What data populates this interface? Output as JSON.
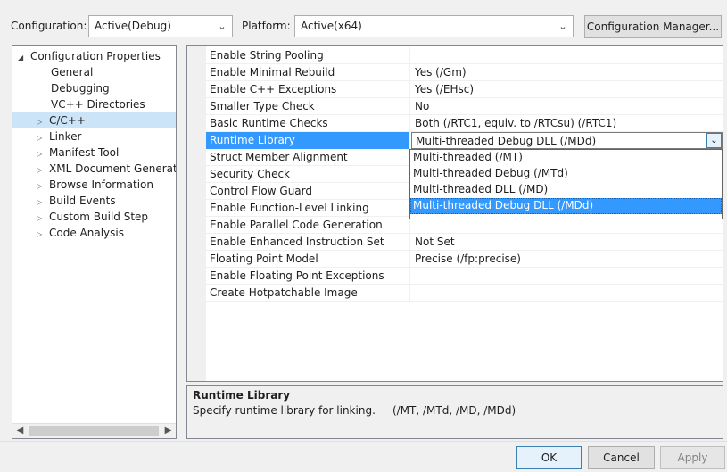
{
  "toolbar": {
    "configuration_label": "Configuration:",
    "configuration_value": "Active(Debug)",
    "platform_label": "Platform:",
    "platform_value": "Active(x64)",
    "config_manager_label": "Configuration Manager..."
  },
  "tree": {
    "items": [
      {
        "label": "Configuration Properties",
        "expander": "◢"
      },
      {
        "label": "General",
        "expander": ""
      },
      {
        "label": "Debugging",
        "expander": ""
      },
      {
        "label": "VC++ Directories",
        "expander": ""
      },
      {
        "label": "C/C++",
        "expander": "▷"
      },
      {
        "label": "Linker",
        "expander": "▷"
      },
      {
        "label": "Manifest Tool",
        "expander": "▷"
      },
      {
        "label": "XML Document Generator",
        "expander": "▷"
      },
      {
        "label": "Browse Information",
        "expander": "▷"
      },
      {
        "label": "Build Events",
        "expander": "▷"
      },
      {
        "label": "Custom Build Step",
        "expander": "▷"
      },
      {
        "label": "Code Analysis",
        "expander": "▷"
      }
    ],
    "selected_index": 4
  },
  "properties": [
    {
      "name": "Enable String Pooling",
      "value": ""
    },
    {
      "name": "Enable Minimal Rebuild",
      "value": "Yes (/Gm)"
    },
    {
      "name": "Enable C++ Exceptions",
      "value": "Yes (/EHsc)"
    },
    {
      "name": "Smaller Type Check",
      "value": "No"
    },
    {
      "name": "Basic Runtime Checks",
      "value": "Both (/RTC1, equiv. to /RTCsu) (/RTC1)"
    },
    {
      "name": "Runtime Library",
      "value": "Multi-threaded Debug DLL (/MDd)"
    },
    {
      "name": "Struct Member Alignment",
      "value": ""
    },
    {
      "name": "Security Check",
      "value": ""
    },
    {
      "name": "Control Flow Guard",
      "value": ""
    },
    {
      "name": "Enable Function-Level Linking",
      "value": ""
    },
    {
      "name": "Enable Parallel Code Generation",
      "value": ""
    },
    {
      "name": "Enable Enhanced Instruction Set",
      "value": "Not Set"
    },
    {
      "name": "Floating Point Model",
      "value": "Precise (/fp:precise)"
    },
    {
      "name": "Enable Floating Point Exceptions",
      "value": ""
    },
    {
      "name": "Create Hotpatchable Image",
      "value": ""
    }
  ],
  "dropdown": {
    "options": [
      "Multi-threaded (/MT)",
      "Multi-threaded Debug (/MTd)",
      "Multi-threaded DLL (/MD)",
      "Multi-threaded Debug DLL (/MDd)"
    ],
    "highlighted_index": 3
  },
  "description": {
    "title": "Runtime Library",
    "text": "Specify runtime library for linking.     (/MT, /MTd, /MD, /MDd)"
  },
  "buttons": {
    "ok": "OK",
    "cancel": "Cancel",
    "apply": "Apply"
  },
  "colors": {
    "selection": "#3399ff",
    "tree_selection": "#cce4f7"
  }
}
